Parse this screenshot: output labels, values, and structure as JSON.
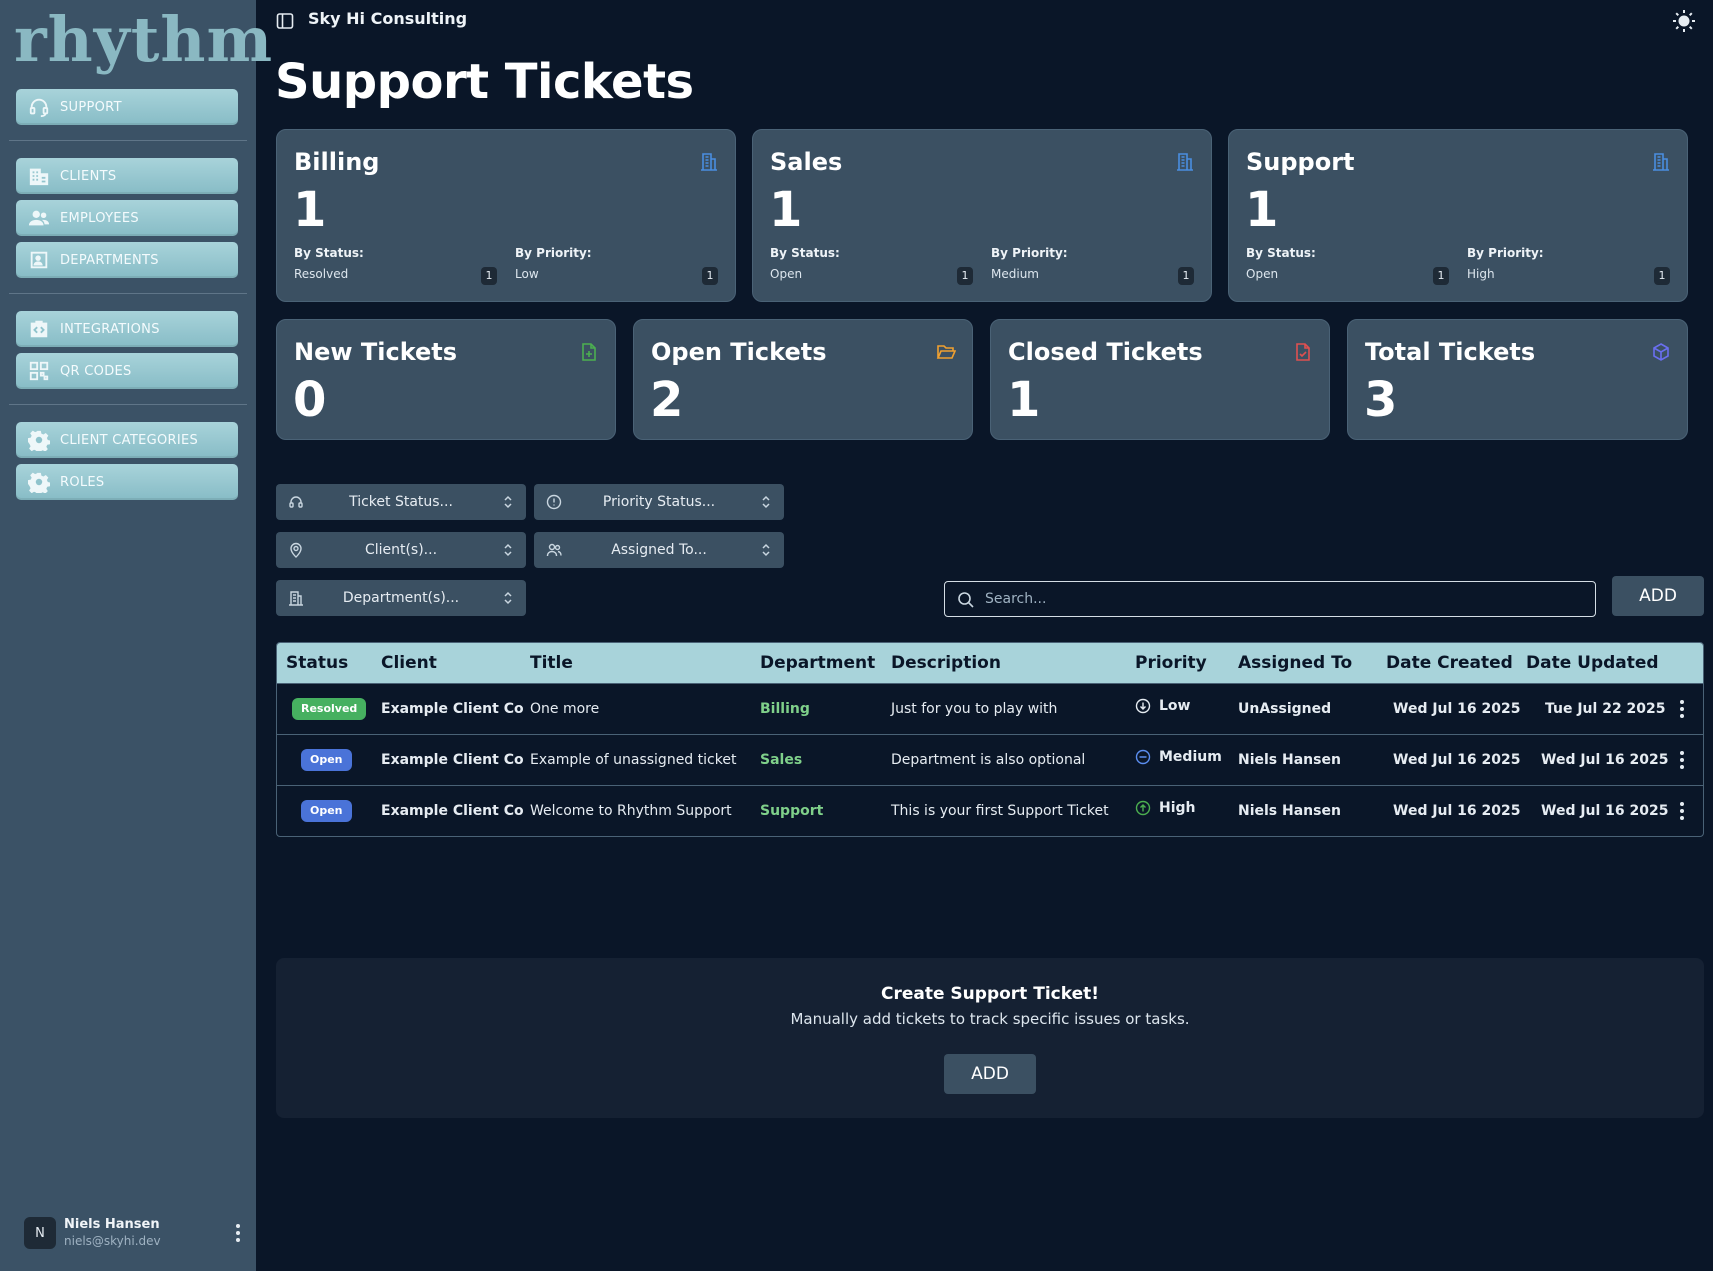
{
  "app": {
    "logo_text": "rhythm",
    "org_name": "Sky Hi Consulting"
  },
  "sidebar": {
    "items": [
      {
        "label": "SUPPORT",
        "icon": "headset-icon"
      },
      {
        "label": "CLIENTS",
        "icon": "building-icon"
      },
      {
        "label": "EMPLOYEES",
        "icon": "people-icon"
      },
      {
        "label": "DEPARTMENTS",
        "icon": "person-badge-icon"
      },
      {
        "label": "INTEGRATIONS",
        "icon": "code-icon"
      },
      {
        "label": "QR CODES",
        "icon": "qr-code-icon"
      },
      {
        "label": "CLIENT CATEGORIES",
        "icon": "gear-icon"
      },
      {
        "label": "ROLES",
        "icon": "gear-icon"
      }
    ],
    "user": {
      "initial": "N",
      "name": "Niels Hansen",
      "email": "niels@skyhi.dev"
    }
  },
  "page": {
    "title": "Support Tickets"
  },
  "departments": [
    {
      "name": "Billing",
      "count": "1",
      "by_status_label": "By Status:",
      "status": "Resolved",
      "status_count": "1",
      "by_priority_label": "By Priority:",
      "priority": "Low",
      "priority_count": "1"
    },
    {
      "name": "Sales",
      "count": "1",
      "by_status_label": "By Status:",
      "status": "Open",
      "status_count": "1",
      "by_priority_label": "By Priority:",
      "priority": "Medium",
      "priority_count": "1"
    },
    {
      "name": "Support",
      "count": "1",
      "by_status_label": "By Status:",
      "status": "Open",
      "status_count": "1",
      "by_priority_label": "By Priority:",
      "priority": "High",
      "priority_count": "1"
    }
  ],
  "stats": [
    {
      "label": "New Tickets",
      "value": "0",
      "icon": "file-plus-icon",
      "color": "#4caf50"
    },
    {
      "label": "Open Tickets",
      "value": "2",
      "icon": "folder-open-icon",
      "color": "#f0a030"
    },
    {
      "label": "Closed Tickets",
      "value": "1",
      "icon": "file-check-icon",
      "color": "#e05050"
    },
    {
      "label": "Total Tickets",
      "value": "3",
      "icon": "cube-icon",
      "color": "#6a6ff0"
    }
  ],
  "filters": {
    "ticket_status": "Ticket Status...",
    "priority_status": "Priority Status...",
    "clients": "Client(s)...",
    "assigned_to": "Assigned To...",
    "departments": "Department(s)..."
  },
  "search": {
    "placeholder": "Search..."
  },
  "add_label": "ADD",
  "table": {
    "headers": [
      "Status",
      "Client",
      "Title",
      "Department",
      "Description",
      "Priority",
      "Assigned To",
      "Date Created",
      "Date Updated"
    ],
    "rows": [
      {
        "status": "Resolved",
        "client": "Example Client Co",
        "title": "One more",
        "department": "Billing",
        "description": "Just for you to play with",
        "priority": "Low",
        "assigned": "UnAssigned",
        "created": "Wed Jul 16 2025",
        "updated": "Tue Jul 22 2025"
      },
      {
        "status": "Open",
        "client": "Example Client Co",
        "title": "Example of unassigned ticket",
        "department": "Sales",
        "description": "Department is also optional",
        "priority": "Medium",
        "assigned": "Niels Hansen",
        "created": "Wed Jul 16 2025",
        "updated": "Wed Jul 16 2025"
      },
      {
        "status": "Open",
        "client": "Example Client Co",
        "title": "Welcome to Rhythm Support",
        "department": "Support",
        "description": "This is your first Support Ticket",
        "priority": "High",
        "assigned": "Niels Hansen",
        "created": "Wed Jul 16 2025",
        "updated": "Wed Jul 16 2025"
      }
    ]
  },
  "cta": {
    "title": "Create Support Ticket!",
    "subtitle": "Manually add tickets to track specific issues or tasks.",
    "button": "ADD"
  },
  "colors": {
    "accent": "#a8d3da",
    "sidebar": "#3b5266",
    "background": "#0a1628",
    "card": "#3b5062"
  }
}
